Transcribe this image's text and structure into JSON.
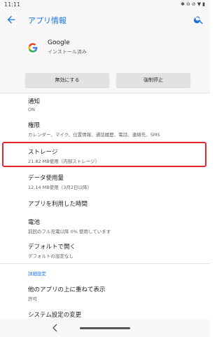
{
  "status": {
    "time": "11:11",
    "icons": [
      "bluetooth-icon",
      "dnd-icon",
      "no-sim-icon",
      "wifi-icon",
      "battery-icon"
    ]
  },
  "appbar": {
    "title": "アプリ情報",
    "back_icon": "arrow-back-icon",
    "search_icon": "search-icon"
  },
  "app": {
    "name": "Google",
    "status": "インストール済み",
    "icon": "google-g-logo"
  },
  "buttons": {
    "disable": "無効にする",
    "force_stop": "強制停止"
  },
  "items": [
    {
      "id": "notifications",
      "title": "通知",
      "sub": "ON"
    },
    {
      "id": "permissions",
      "title": "権限",
      "sub": "カレンダー、マイク、位置情報、通話履歴、電話、連絡先、SMS"
    },
    {
      "id": "storage",
      "title": "ストレージ",
      "sub": "21.82 MB使用（内部ストレージ）"
    },
    {
      "id": "data-usage",
      "title": "データ使用量",
      "sub": "12.14 MB使用（3月2日以降）"
    },
    {
      "id": "app-time",
      "title": "アプリを利用した時間",
      "sub": ""
    },
    {
      "id": "battery",
      "title": "電池",
      "sub": "前回のフル充電以降 0% 使用しています"
    },
    {
      "id": "open-default",
      "title": "デフォルトで開く",
      "sub": "デフォルトの設定なし"
    }
  ],
  "advanced": {
    "section_label": "詳細設定",
    "items": [
      {
        "id": "draw-over",
        "title": "他のアプリの上に重ねて表示",
        "sub": "許可"
      },
      {
        "id": "modify-system",
        "title": "システム設定の変更",
        "sub": ""
      }
    ]
  },
  "colors": {
    "accent": "#1a73e8",
    "highlight": "#e5262d"
  }
}
